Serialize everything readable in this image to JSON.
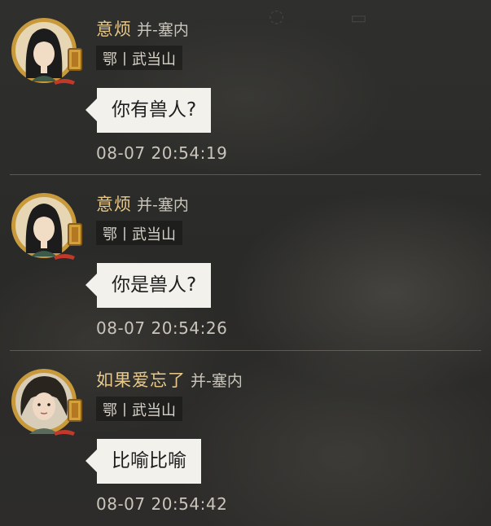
{
  "messages": [
    {
      "sender": "意烦",
      "server": "并-塞内",
      "region": "鄂丨武当山",
      "text": "你有兽人?",
      "time": "08-07 20:54:19",
      "avatar": "female-hero-black-hair-avatar"
    },
    {
      "sender": "意烦",
      "server": "并-塞内",
      "region": "鄂丨武当山",
      "text": "你是兽人?",
      "time": "08-07 20:54:26",
      "avatar": "female-hero-black-hair-avatar"
    },
    {
      "sender": "如果爱忘了",
      "server": "并-塞内",
      "region": "鄂丨武当山",
      "text": "比喻比喻",
      "time": "08-07 20:54:42",
      "avatar": "female-hero-dark-curly-hair-avatar"
    }
  ],
  "colors": {
    "name": "#e8c98a",
    "server": "#c9c5bb",
    "bubble": "#f3f1ec",
    "avatar_frame": "#c99a3c"
  }
}
